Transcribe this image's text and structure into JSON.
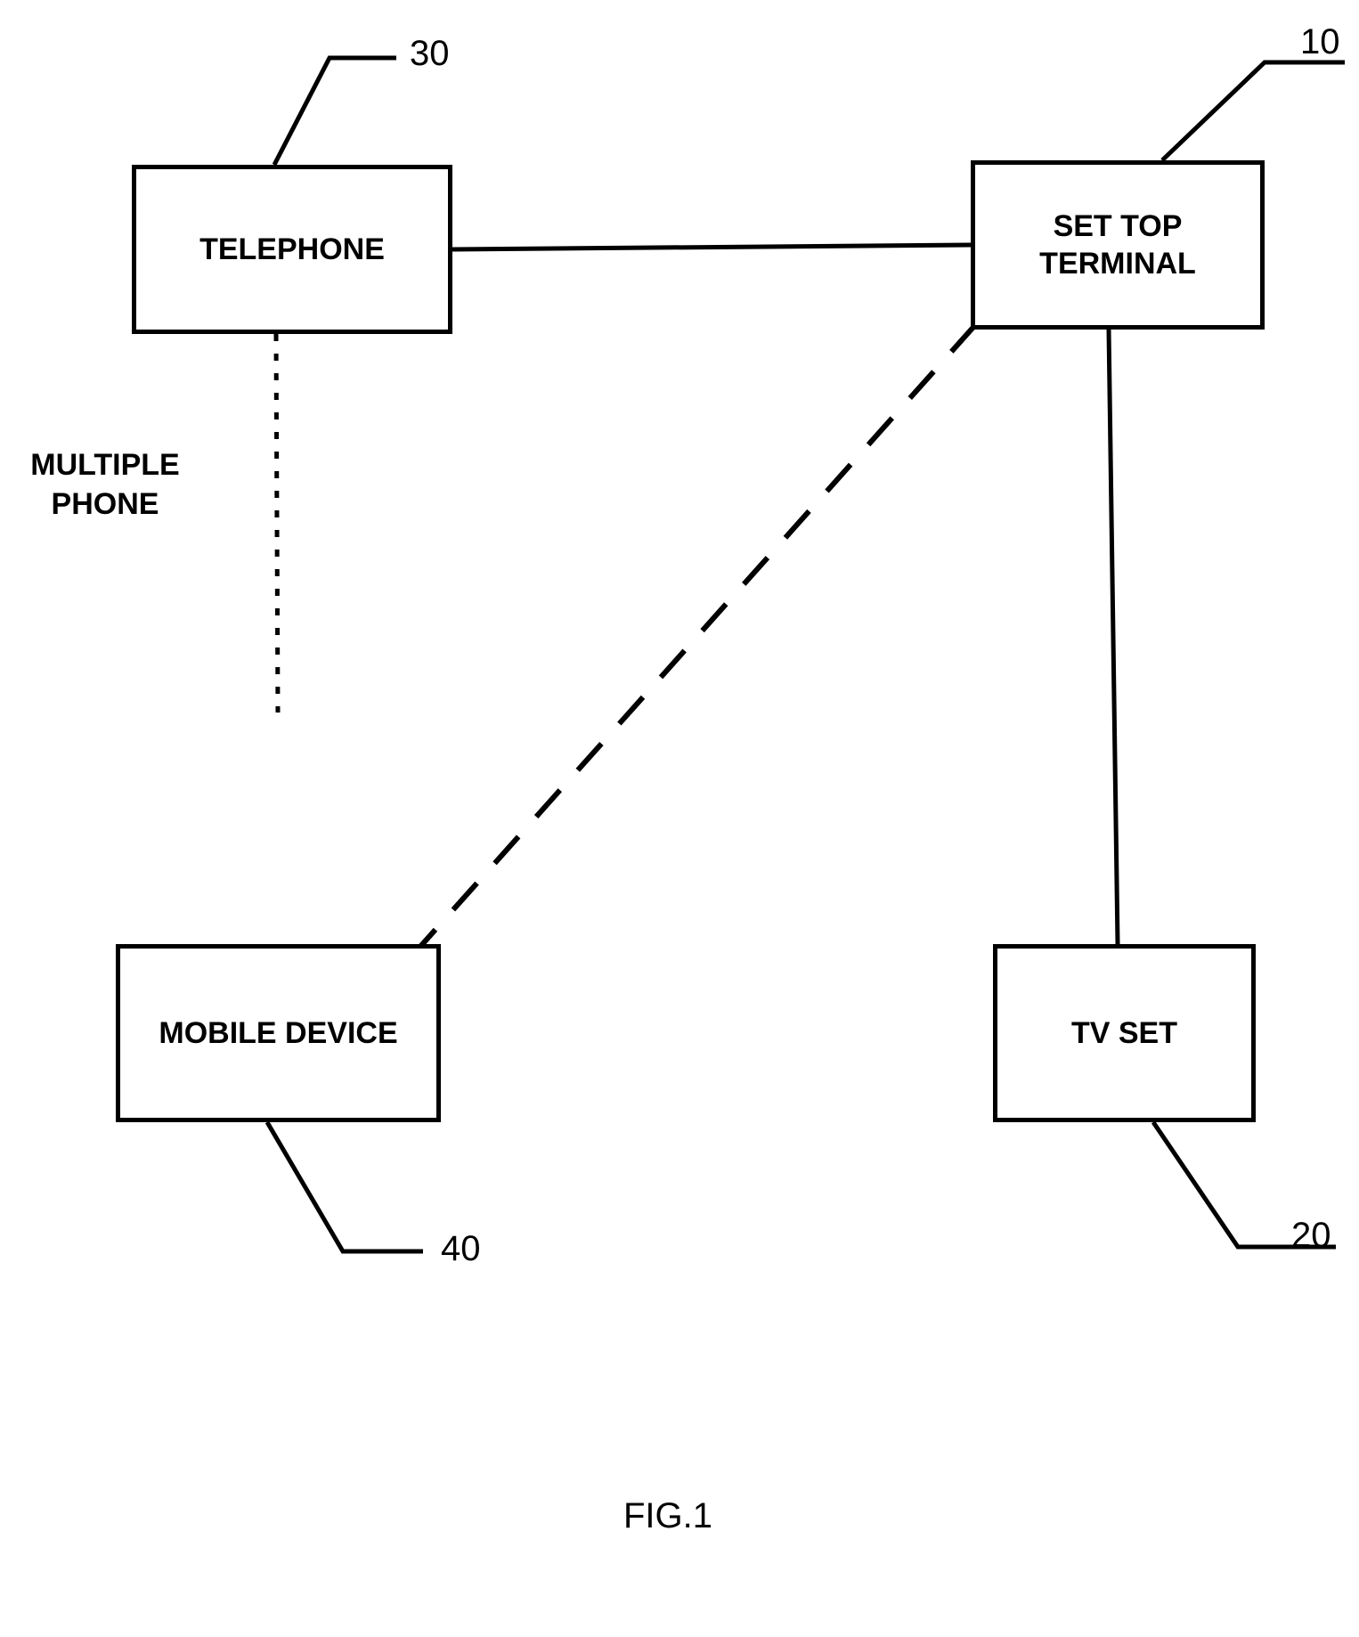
{
  "figure_label": "FIG.1",
  "side_label": "MULTIPLE\nPHONE",
  "boxes": {
    "telephone": {
      "label": "TELEPHONE",
      "ref": "30"
    },
    "settop": {
      "label": "SET TOP\nTERMINAL",
      "ref": "10"
    },
    "mobile": {
      "label": "MOBILE DEVICE",
      "ref": "40"
    },
    "tvset": {
      "label": "TV SET",
      "ref": "20"
    }
  }
}
